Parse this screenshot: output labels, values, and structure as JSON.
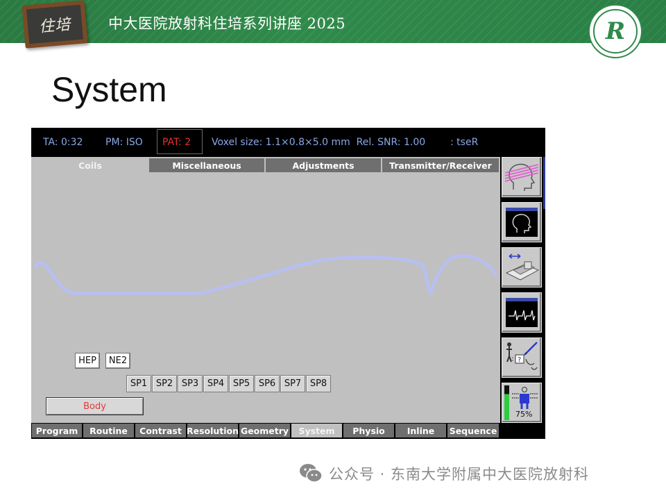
{
  "header": {
    "badge_text": "住培",
    "title": "中大医院放射科住培系列讲座 2025",
    "logo_letter": "R"
  },
  "slide": {
    "title": "System"
  },
  "status": {
    "ta": "TA: 0:32",
    "pm": "PM: ISO",
    "pat": "PAT: 2",
    "voxel": "Voxel size: 1.1×0.8×5.0 mm",
    "snr": "Rel. SNR: 1.00",
    "seq": ": tseR"
  },
  "top_tabs": [
    "Coils",
    "Miscellaneous",
    "Adjustments",
    "Transmitter/Receiver"
  ],
  "active_top_tab": 0,
  "coils": {
    "elements": [
      "HEP",
      "NE2"
    ],
    "spine": [
      "SP1",
      "SP2",
      "SP3",
      "SP4",
      "SP5",
      "SP6",
      "SP7",
      "SP8"
    ],
    "body": "Body"
  },
  "bottom_tabs": [
    "Program",
    "Routine",
    "Contrast",
    "Resolution",
    "Geometry",
    "System",
    "Physio",
    "Inline",
    "Sequence"
  ],
  "active_bottom_tab": 5,
  "side": {
    "buttons": [
      "head-slices-icon",
      "head-view-icon",
      "table-move-icon",
      "ecg-monitor-icon",
      "patient-help-icon",
      "sar-monitor-icon"
    ],
    "sar_percent": "75%",
    "sar_level": 0.75
  },
  "colors": {
    "banner_green": "#2f8a4a",
    "status_text": "#8aa8e8",
    "pat_red": "#e83030",
    "panel_gray": "#c0c0c0",
    "tab_gray": "#6f6f6f"
  },
  "footer": {
    "text": "公众号 · 东南大学附属中大医院放射科"
  }
}
